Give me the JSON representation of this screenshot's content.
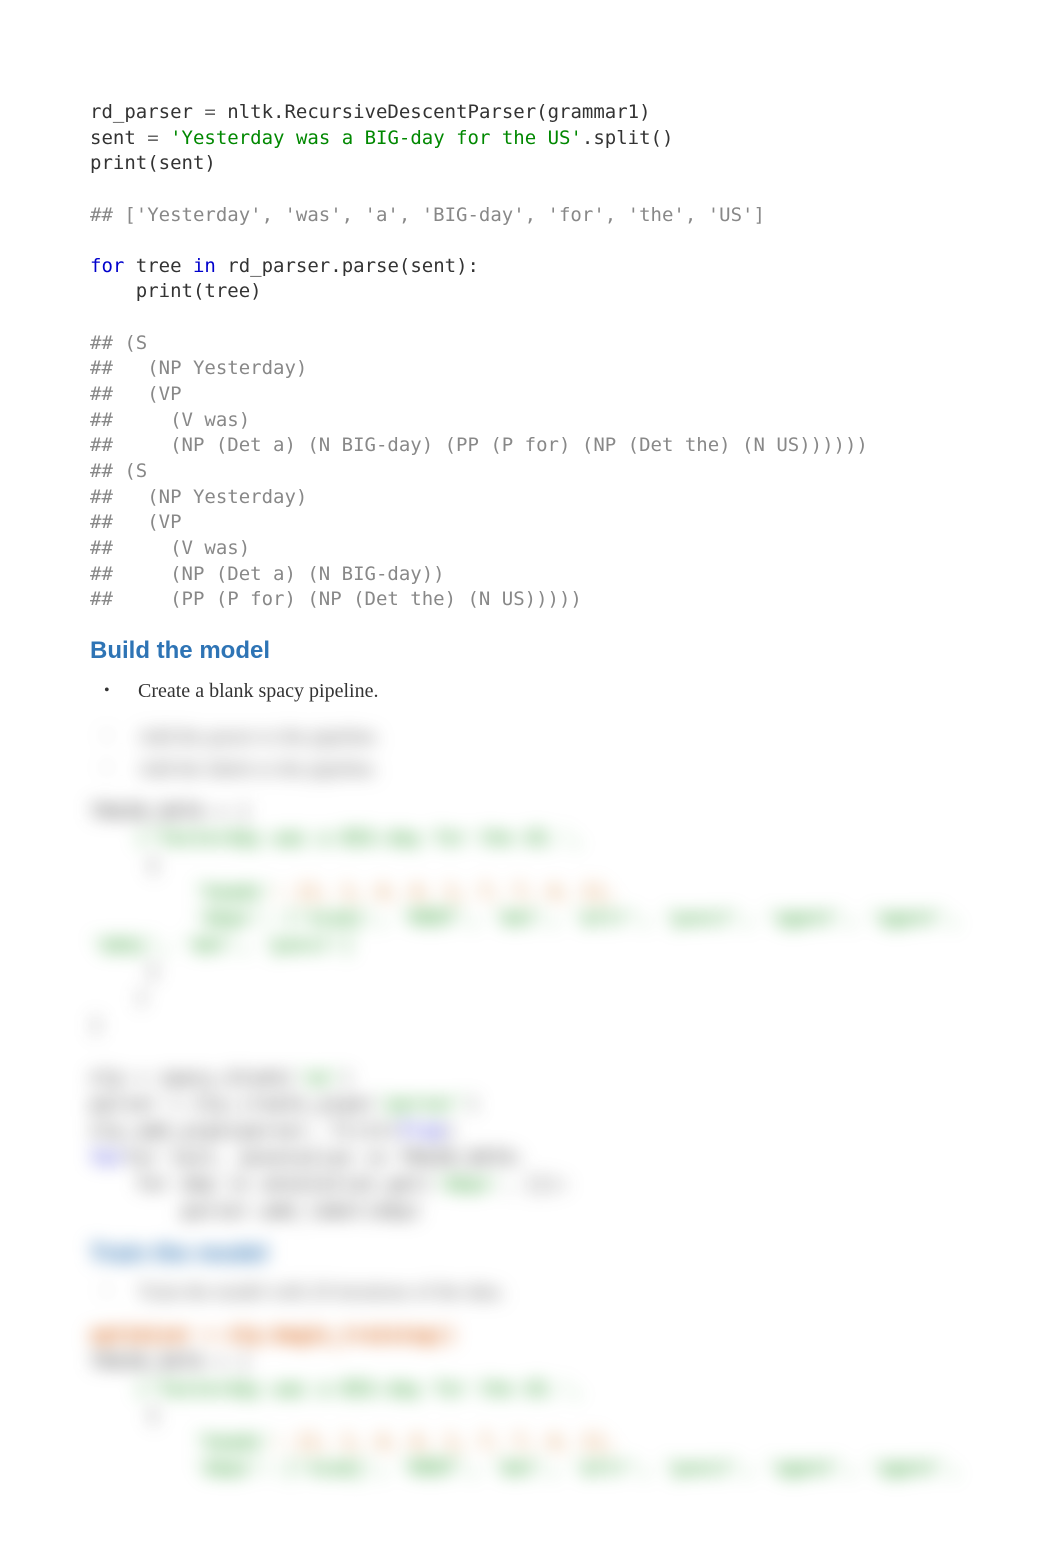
{
  "code": {
    "l1a": "rd_parser ",
    "l1b": "=",
    "l1c": " nltk.RecursiveDescentParser(grammar1)",
    "l2a": "sent ",
    "l2b": "=",
    "l2c": " ",
    "l2d": "'Yesterday was a BIG-day for the US'",
    "l2e": ".split()",
    "l3": "print(sent)",
    "l5": "## ['Yesterday', 'was', 'a', 'BIG-day', 'for', 'the', 'US']",
    "l7a": "for",
    "l7b": " tree ",
    "l7c": "in",
    "l7d": " rd_parser.parse(sent):",
    "l8": "    print(tree)",
    "l10": "## (S",
    "l11": "##   (NP Yesterday)",
    "l12": "##   (VP",
    "l13": "##     (V was)",
    "l14": "##     (NP (Det a) (N BIG-day) (PP (P for) (NP (Det the) (N US))))))",
    "l15": "## (S",
    "l16": "##   (NP Yesterday)",
    "l17": "##   (VP",
    "l18": "##     (V was)",
    "l19": "##     (NP (Det a) (N BIG-day))",
    "l20": "##     (PP (P for) (NP (Det the) (N US)))))"
  },
  "heading1": "Build the model",
  "bullet1": "Create a blank spacy pipeline.",
  "blur": {
    "b1": "Add the parser to the pipeline.",
    "b2": "Add the labels to the pipeline.",
    "train_data": "TRAIN_DATA",
    "eq": " = [",
    "sent1": "    ('Yesterday was a BIG-day for the US.',",
    "sent2": "     {",
    "heads_lbl": "         'heads'",
    "heads_val": ": [1, 1, 4, 4, 1, 7, 7, 4, 1],",
    "deps_lbl": "         'deps'",
    "deps_val": ": ['nsubj', 'ROOT', 'det', 'attr', 'punct', 'agent', 'agent',",
    "deps_val2": "'dobj', 'det', 'punct']",
    "close1": "     }",
    "close2": "    )",
    "close3": "]",
    "nlp_line": "nlp = spacy.blank(",
    "en": "'en'",
    "paren": ")",
    "parse_line": "parser = nlp.create_pipe(",
    "parser_str": "'parser'",
    "addpipe": "nlp.add_pipe(parser, first=",
    "true": "True",
    "for_line": "for text, annotation in TRAIN_DATA:",
    "for_dep": "    for dep in annotation.get(",
    "deps_str": "'deps'",
    "deps_end": ", []):",
    "addlbl": "        parser.add_label(dep)",
    "heading2": "Train the model",
    "bullet3": "Train the model with 20 iterations of the data.",
    "optim": "optimizer = nlp.begin_training()",
    "train_data2": "TRAIN_DATA",
    "eq2": " = [",
    "sent1b": "    ('Yesterday was a BIG-day for the US.',",
    "sent2b": "     {",
    "heads_lbl2": "         'heads'",
    "heads_val2": ": [1, 1, 4, 4, 1, 7, 7, 4, 1],",
    "deps_lbl2": "         'deps'",
    "deps_val_b": ": ['nsubj', 'ROOT', 'det', 'attr', 'punct', 'agent', 'agent',"
  }
}
